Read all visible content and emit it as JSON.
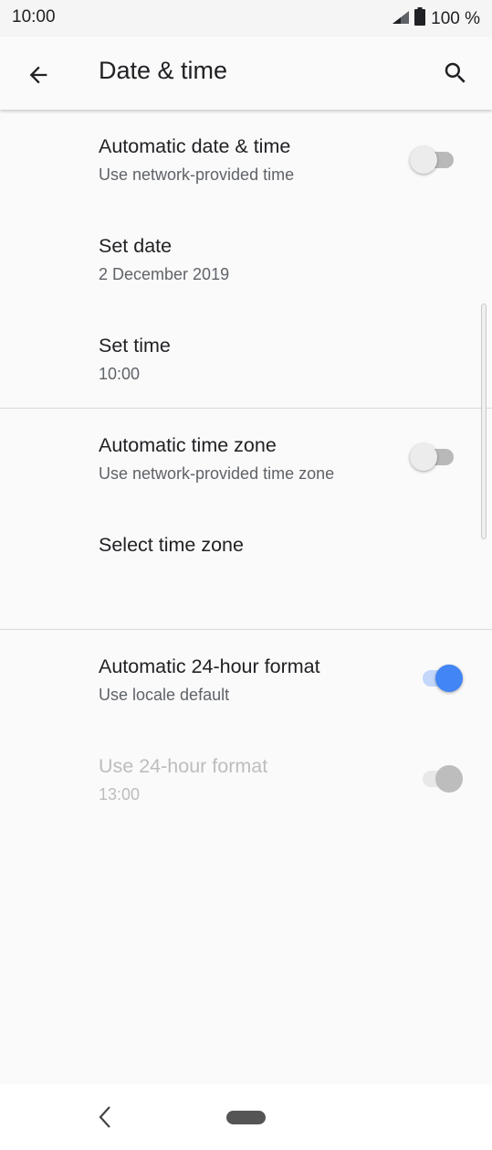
{
  "status_bar": {
    "time": "10:00",
    "battery": "100 %"
  },
  "app_bar": {
    "title": "Date & time"
  },
  "settings": {
    "auto_date_time": {
      "title": "Automatic date & time",
      "summary": "Use network-provided time",
      "enabled": false
    },
    "set_date": {
      "title": "Set date",
      "summary": "2 December 2019"
    },
    "set_time": {
      "title": "Set time",
      "summary": "10:00"
    },
    "auto_time_zone": {
      "title": "Automatic time zone",
      "summary": "Use network-provided time zone",
      "enabled": false
    },
    "select_time_zone": {
      "title": "Select time zone"
    },
    "auto_24_hour": {
      "title": "Automatic 24-hour format",
      "summary": "Use locale default",
      "enabled": true
    },
    "use_24_hour": {
      "title": "Use 24-hour format",
      "summary": "13:00",
      "enabled": true,
      "disabled": true
    }
  },
  "colors": {
    "accent": "#4285f4",
    "background": "#fafafa"
  }
}
